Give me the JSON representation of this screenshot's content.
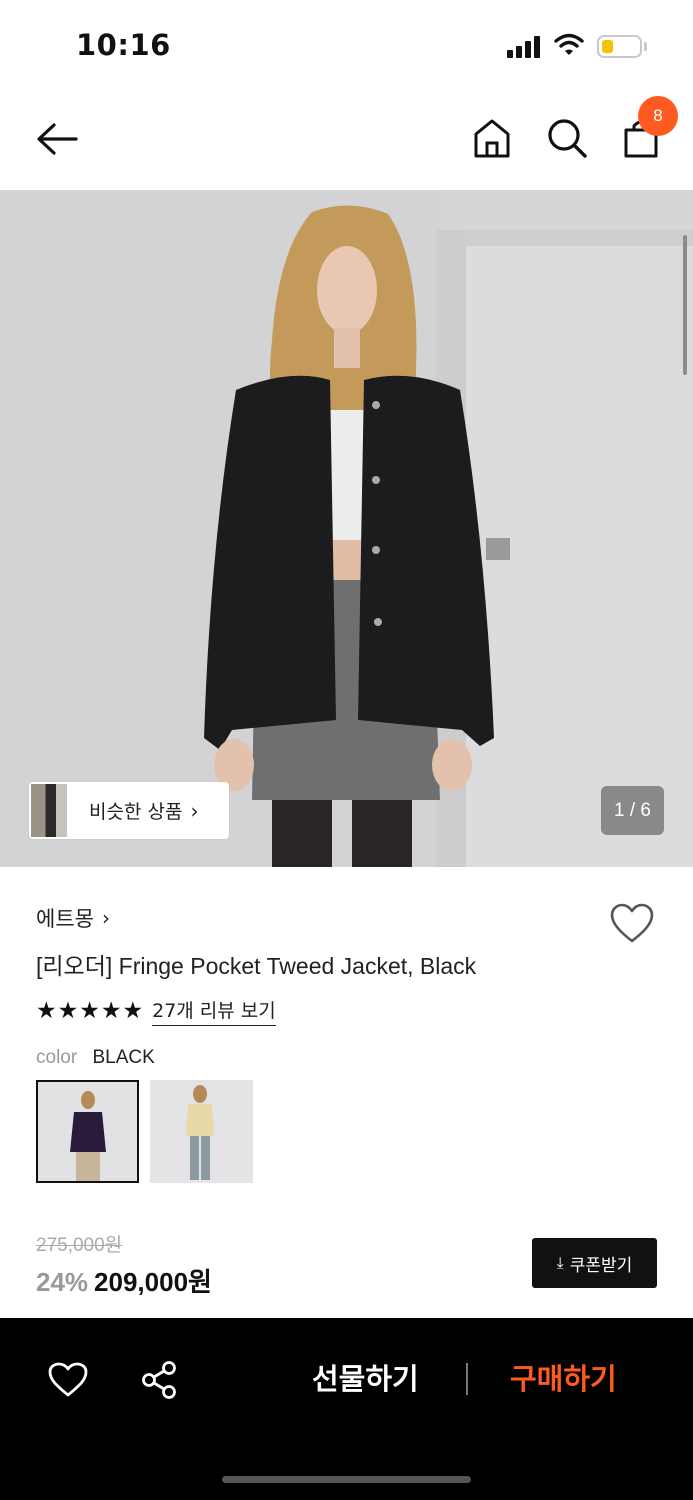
{
  "status_bar": {
    "time": "10:16"
  },
  "nav": {
    "icons": [
      "back-arrow-icon",
      "home-icon",
      "search-icon",
      "shopping-bag-icon"
    ],
    "cart_count": "8"
  },
  "hero": {
    "similar_label": "비슷한 상품",
    "similar_chevron": "›",
    "counter": "1 / 6"
  },
  "product": {
    "brand": "에트몽",
    "brand_chevron": "›",
    "title": "[리오더] Fringe Pocket Tweed Jacket, Black",
    "stars": "★★★★★",
    "rating": 5,
    "review_link": "27개 리뷰 보기",
    "color_label": "color",
    "color_value": "BLACK",
    "price_original": "275,000원",
    "discount": "24%",
    "price_sale": "209,000원",
    "coupon_icon": "⤓",
    "coupon_label": "쿠폰받기"
  },
  "bottom_bar": {
    "gift_label": "선물하기",
    "buy_label": "구매하기"
  },
  "colors": {
    "accent": "#ff5a1f",
    "bottom_bar_bg": "#000000",
    "coupon_bg": "#111111"
  }
}
